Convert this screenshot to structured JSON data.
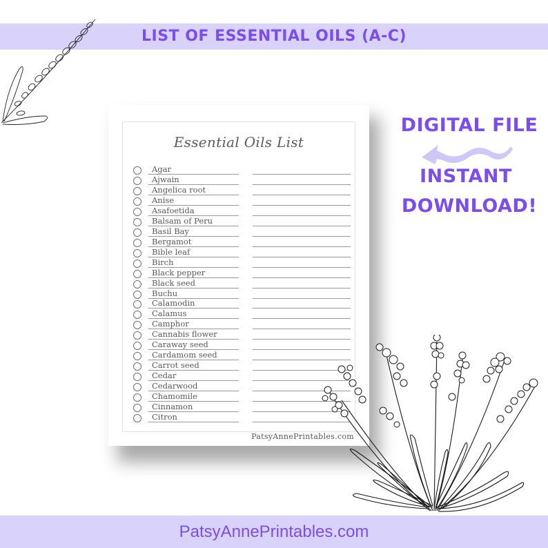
{
  "header": {
    "title": "LIST OF ESSENTIAL OILS (A-C)"
  },
  "decorations": {
    "top_left": "lavender-sprig-icon",
    "bottom_right": "lavender-bouquet-icon",
    "arrow": "wavy-arrow-left-icon"
  },
  "side_callouts": {
    "line1": "DIGITAL FILE",
    "line2": "INSTANT",
    "line3": "DOWNLOAD!"
  },
  "printable": {
    "title": "Essential Oils List",
    "items": [
      "Agar",
      "Ajwain",
      "Angelica root",
      "Anise",
      "Asafoetida",
      "Balsam of Peru",
      "Basil Bay",
      "Bergamot",
      "Bible leaf",
      "Birch",
      "Black pepper",
      "Black seed",
      "Buchu",
      "Calamodin",
      "Calamus",
      "Camphor",
      "Cannabis flower",
      "Caraway seed",
      "Cardamom seed",
      "Carrot seed",
      "Cedar",
      "Cedarwood",
      "Chamomile",
      "Cinnamon",
      "Citron"
    ],
    "footer": "PatsyAnnePrintables.com"
  },
  "footer": {
    "website": "PatsyAnnePrintables.com"
  },
  "colors": {
    "accent": "#7b4cf0",
    "banner": "#d9d3fb",
    "arrow": "#cfc8f7"
  }
}
